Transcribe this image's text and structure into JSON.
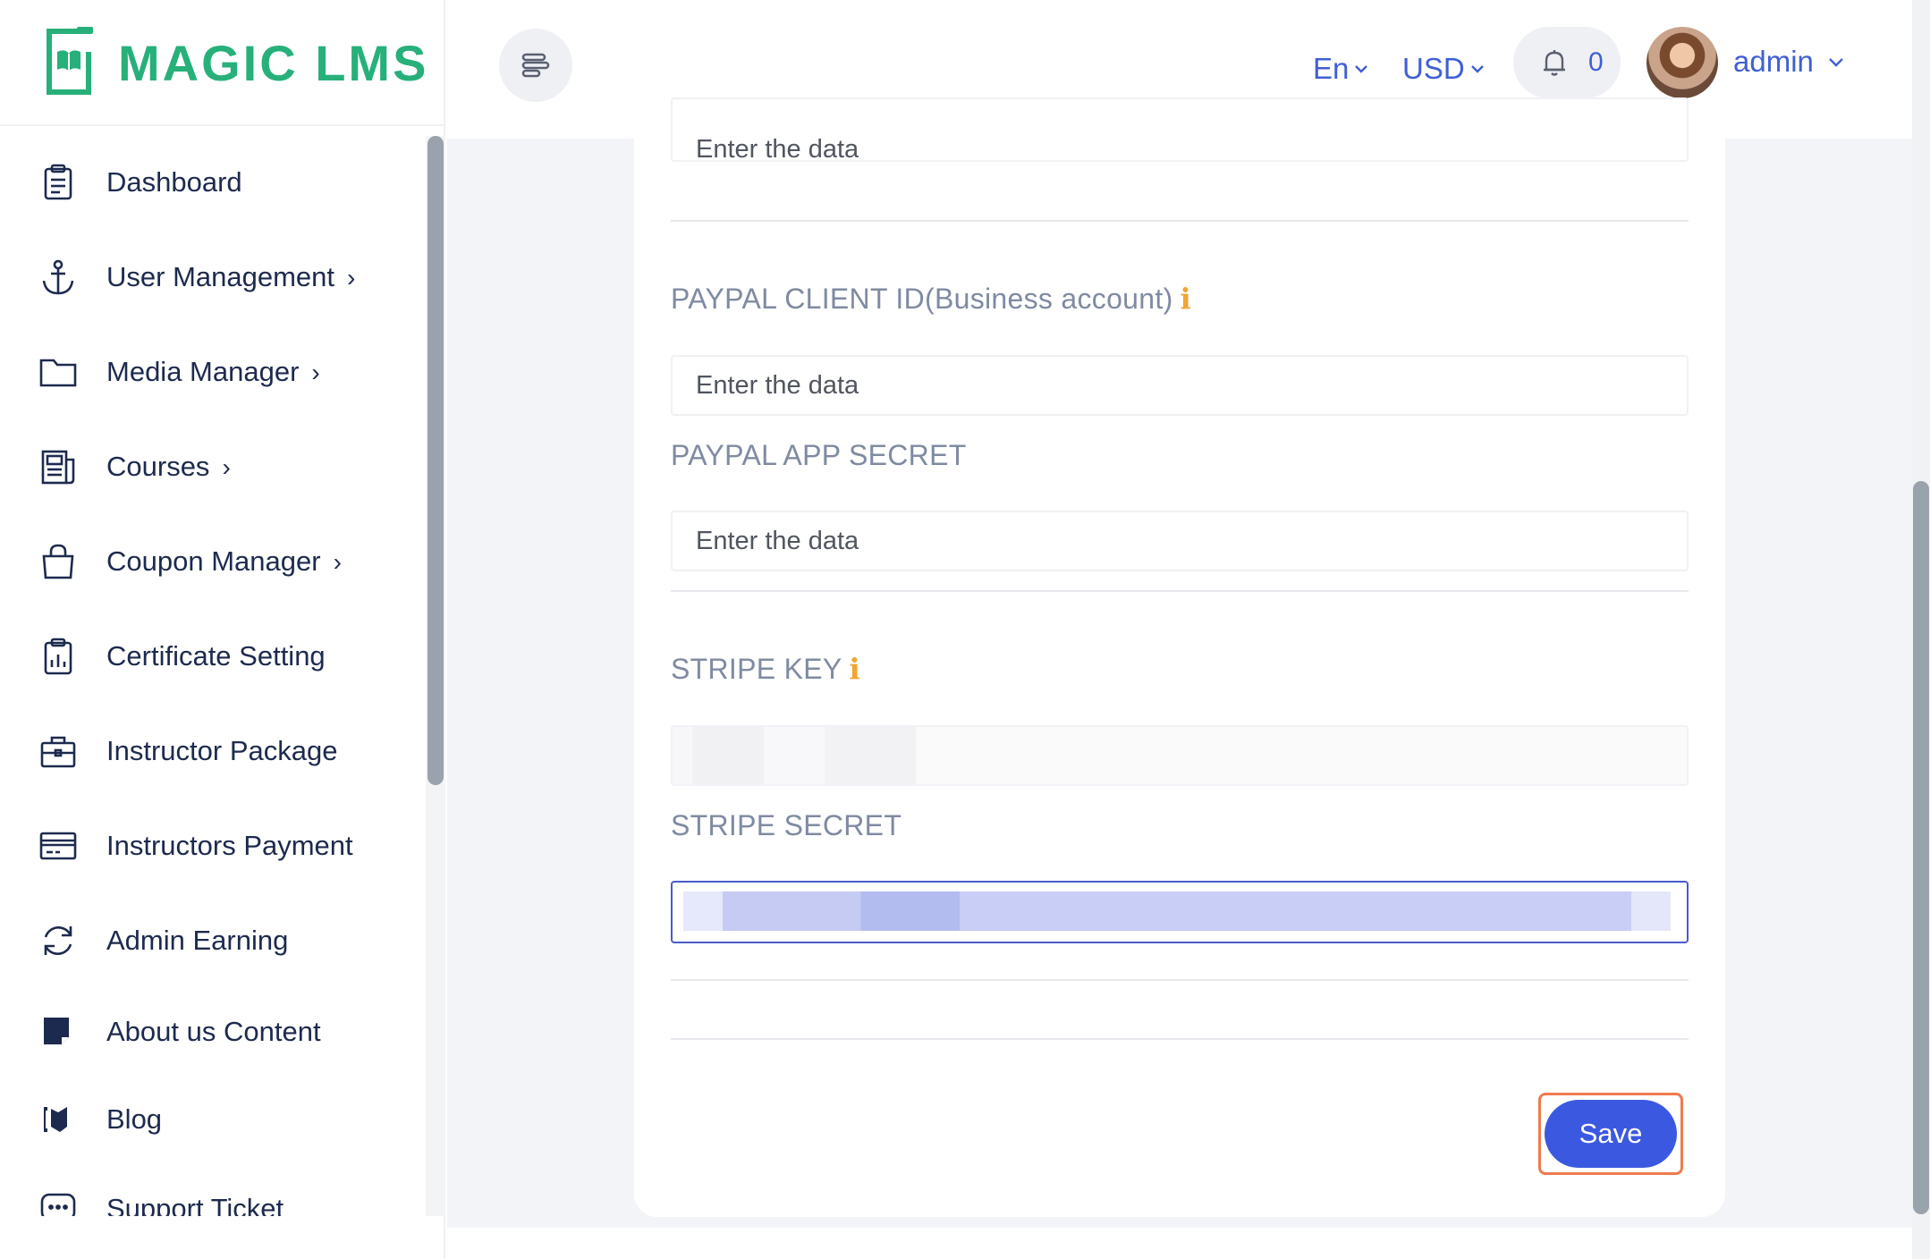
{
  "brand": {
    "name": "MAGIC LMS",
    "color": "#27b07a"
  },
  "sidebar": {
    "items": [
      {
        "label": "Dashboard",
        "icon": "clipboard-list-icon",
        "has_chevron": false
      },
      {
        "label": "User Management",
        "icon": "anchor-icon",
        "has_chevron": true
      },
      {
        "label": "Media Manager",
        "icon": "folder-icon",
        "has_chevron": true
      },
      {
        "label": "Courses",
        "icon": "newspaper-icon",
        "has_chevron": true
      },
      {
        "label": "Coupon Manager",
        "icon": "shopping-bag-icon",
        "has_chevron": true
      },
      {
        "label": "Certificate Setting",
        "icon": "clipboard-chart-icon",
        "has_chevron": false
      },
      {
        "label": "Instructor Package",
        "icon": "briefcase-icon",
        "has_chevron": false
      },
      {
        "label": "Instructors Payment",
        "icon": "credit-card-icon",
        "has_chevron": false
      },
      {
        "label": "Admin Earning",
        "icon": "refresh-icon",
        "has_chevron": false
      },
      {
        "label": "About us Content",
        "icon": "sticky-note-icon",
        "has_chevron": false
      },
      {
        "label": "Blog",
        "icon": "blog-icon",
        "has_chevron": false
      },
      {
        "label": "Support Ticket",
        "icon": "chat-dots-icon",
        "has_chevron": false
      }
    ],
    "chevron": "›"
  },
  "header": {
    "language": "En",
    "currency": "USD",
    "notification_count": "0",
    "user_name": "admin",
    "accent": "#3f5fd4"
  },
  "form": {
    "top_input_placeholder": "Enter the data",
    "paypal_client_label": "PAYPAL CLIENT ID(Business account)",
    "paypal_client_placeholder": "Enter the data",
    "paypal_secret_label": "PAYPAL APP SECRET",
    "paypal_secret_placeholder": "Enter the data",
    "stripe_key_label": "STRIPE KEY",
    "stripe_secret_label": "STRIPE SECRET",
    "info_glyph": "i",
    "save_label": "Save"
  }
}
